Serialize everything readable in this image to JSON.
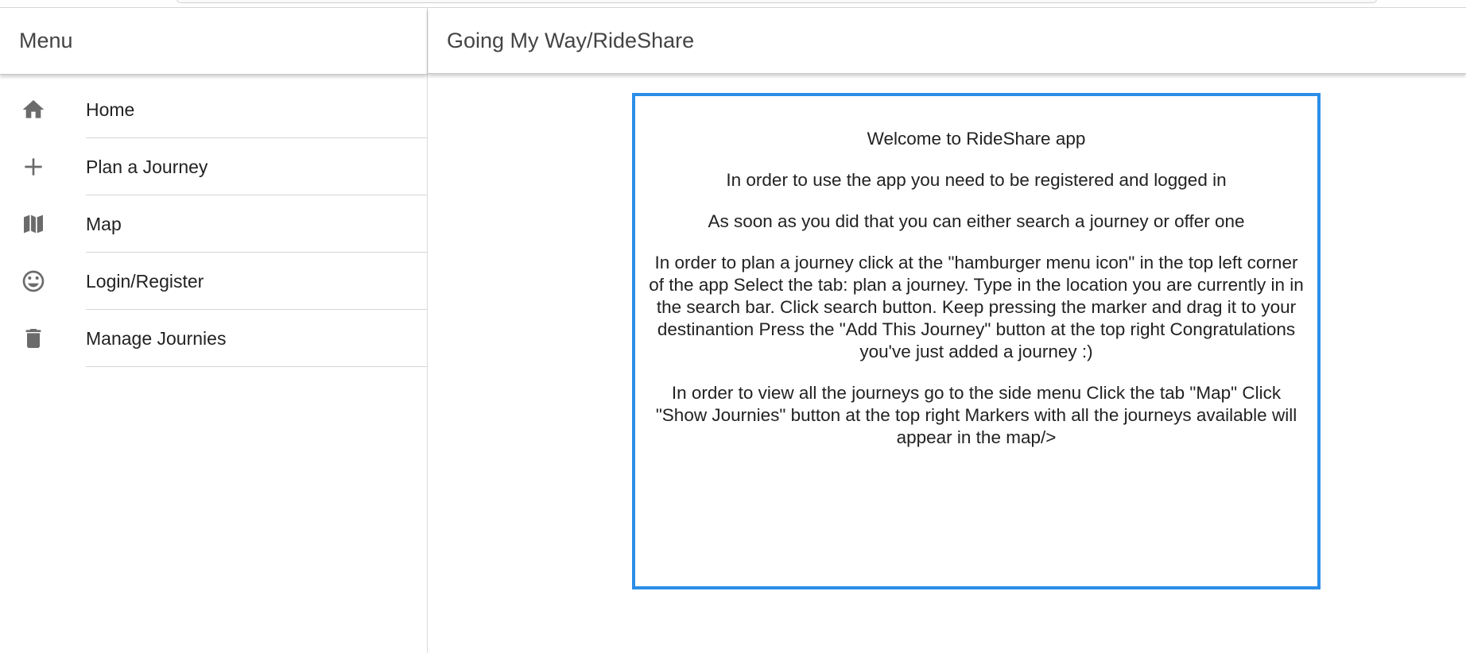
{
  "side_menu": {
    "title": "Menu",
    "items": [
      {
        "label": "Home",
        "icon": "home-icon"
      },
      {
        "label": "Plan a Journey",
        "icon": "plus-icon"
      },
      {
        "label": "Map",
        "icon": "map-icon"
      },
      {
        "label": "Login/Register",
        "icon": "smiley-icon"
      },
      {
        "label": "Manage Journies",
        "icon": "trash-icon"
      }
    ]
  },
  "header": {
    "title": "Going My Way/RideShare"
  },
  "content": {
    "paragraphs": [
      "Welcome to RideShare app",
      "In order to use the app you need to be registered and logged in",
      "As soon as you did that you can either search a journey or offer one",
      "In order to plan a journey click at the \"hamburger menu icon\" in the top left corner of the app Select the tab: plan a journey. Type in the location you are currently in in the search bar. Click search button. Keep pressing the marker and drag it to your destinantion Press the \"Add This Journey\" button at the top right Congratulations you've just added a journey :)",
      "In order to view all the journeys go to the side menu Click the tab \"Map\" Click \"Show Journies\" button at the top right Markers with all the journeys available will appear in the map/>"
    ]
  },
  "colors": {
    "accent_border": "#2b8ee8",
    "icon_gray": "#6b6b6b"
  }
}
